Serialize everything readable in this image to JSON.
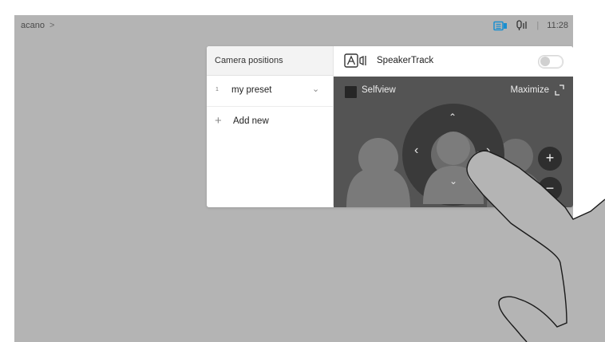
{
  "topbar": {
    "breadcrumb": "acano",
    "breadcrumb_chevron": ">",
    "time": "11:28",
    "separator": "|",
    "icons": [
      "video-camera-icon",
      "microphone-icon"
    ]
  },
  "camera_positions": {
    "title": "Camera positions",
    "presets": [
      {
        "number": "1",
        "name": "my preset",
        "chevron": "⌄"
      }
    ],
    "add_icon": "+",
    "add_label": "Add new"
  },
  "speakertrack": {
    "label": "SpeakerTrack",
    "enabled": false
  },
  "video": {
    "selfview_label": "Selfview",
    "maximize_label": "Maximize",
    "pan_left": "‹",
    "pan_right": "›",
    "tilt_up": "⌃",
    "tilt_down": "⌄",
    "zoom_in": "+",
    "zoom_out": "−"
  },
  "colors": {
    "screen_bg": "#b4b4b4",
    "accent_icon": "#1a8fd0",
    "video_bg": "#545454"
  }
}
